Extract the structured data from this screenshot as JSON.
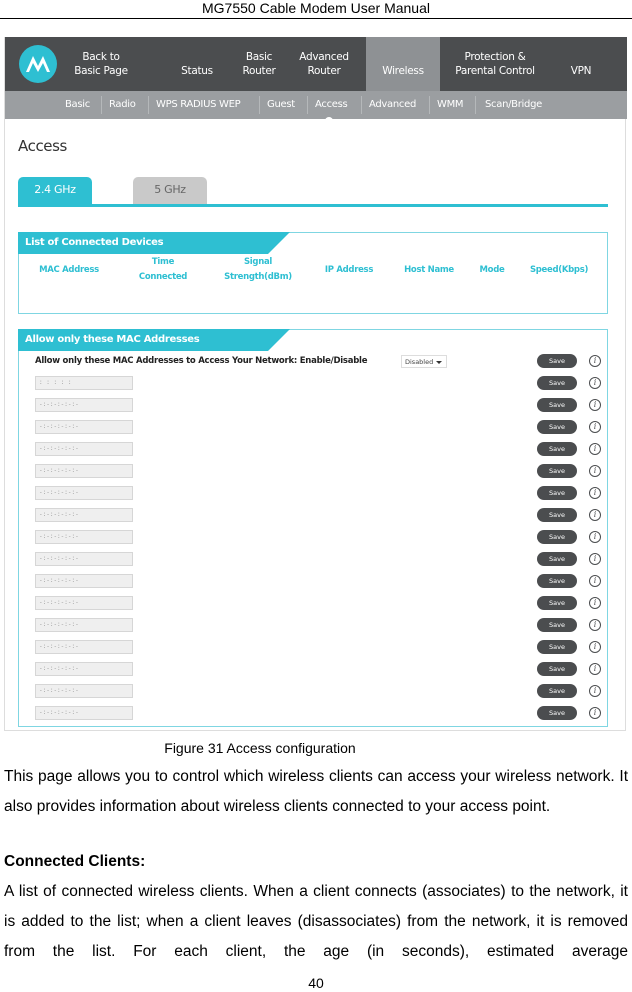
{
  "document": {
    "header": "MG7550 Cable Modem User Manual",
    "caption": "Figure 31 Access configuration",
    "paragraph1": "This page allows you to control which wireless clients can access your wireless network. It also provides information about wireless clients connected to your access point.",
    "heading_connected_clients": "Connected Clients:",
    "paragraph2": "A list of connected wireless clients. When a client connects (associates) to the network, it is added to the list; when a client leaves (disassociates) from the network, it is removed from the list. For each client, the age (in seconds), estimated average",
    "page_number": "40"
  },
  "screenshot": {
    "brand_color": "#2ebfd2",
    "logo_icon": "motorola-logo-icon",
    "top_nav": [
      {
        "line1": "Back to",
        "line2": "Basic Page",
        "active": false
      },
      {
        "line1": "",
        "line2": "Status",
        "active": false
      },
      {
        "line1": "Basic",
        "line2": "Router",
        "active": false
      },
      {
        "line1": "Advanced",
        "line2": "Router",
        "active": false
      },
      {
        "line1": "",
        "line2": "Wireless",
        "active": true
      },
      {
        "line1": "Protection &",
        "line2": "Parental Control",
        "active": false
      },
      {
        "line1": "",
        "line2": "VPN",
        "active": false
      }
    ],
    "sub_nav": [
      "Basic",
      "Radio",
      "WPS RADIUS WEP",
      "Guest",
      "Access",
      "Advanced",
      "WMM",
      "Scan/Bridge"
    ],
    "sub_nav_active": "Access",
    "page_title": "Access",
    "band_tabs": [
      {
        "label": "2.4 GHz",
        "active": true
      },
      {
        "label": "5 GHz",
        "active": false
      }
    ],
    "connected_devices": {
      "title": "List of Connected Devices",
      "columns": [
        {
          "line1": "",
          "line2": "MAC Address"
        },
        {
          "line1": "Time",
          "line2": "Connected"
        },
        {
          "line1": "Signal",
          "line2": "Strength(dBm)"
        },
        {
          "line1": "",
          "line2": "IP Address"
        },
        {
          "line1": "",
          "line2": "Host Name"
        },
        {
          "line1": "",
          "line2": "Mode"
        },
        {
          "line1": "",
          "line2": "Speed(Kbps)"
        }
      ],
      "rows": []
    },
    "mac_filter": {
      "title": "Allow only these MAC Addresses",
      "label": "Allow only these MAC Addresses to Access Your Network: Enable/Disable",
      "select_value": "Disabled",
      "save_label": "Save",
      "info_icon": "i",
      "entries": [
        ": : : : :",
        "-:-:-:-:-:-",
        "-:-:-:-:-:-",
        "-:-:-:-:-:-",
        "-:-:-:-:-:-",
        "-:-:-:-:-:-",
        "-:-:-:-:-:-",
        "-:-:-:-:-:-",
        "-:-:-:-:-:-",
        "-:-:-:-:-:-",
        "-:-:-:-:-:-",
        "-:-:-:-:-:-",
        "-:-:-:-:-:-",
        "-:-:-:-:-:-",
        "-:-:-:-:-:-",
        "-:-:-:-:-:-"
      ]
    }
  }
}
